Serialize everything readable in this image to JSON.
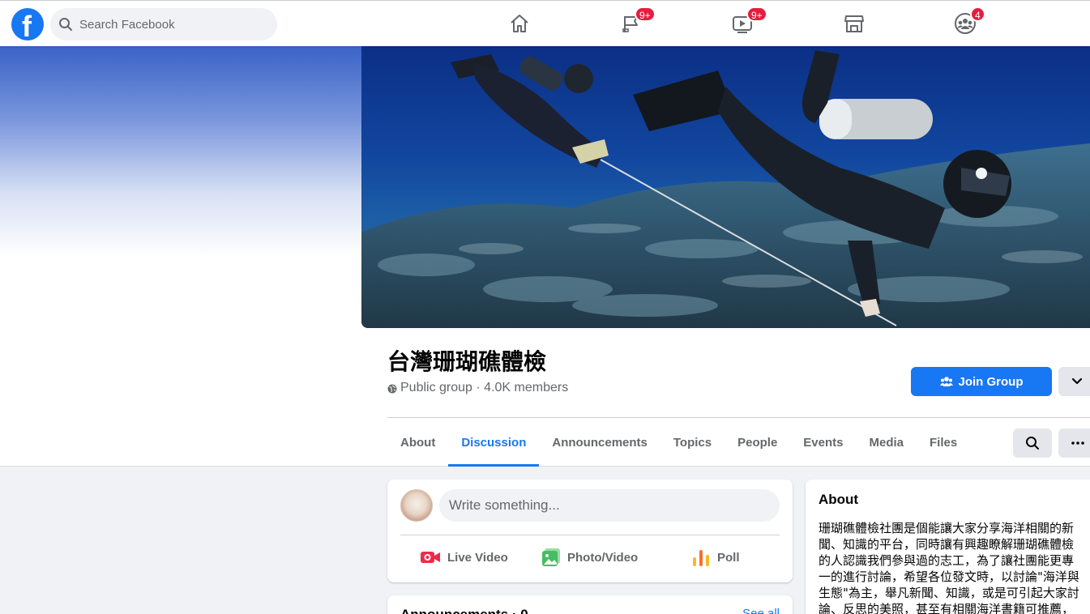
{
  "topbar": {
    "logo_letter": "f",
    "search_placeholder": "Search Facebook",
    "nav": [
      {
        "name": "home",
        "badge": ""
      },
      {
        "name": "pages",
        "badge": "9+"
      },
      {
        "name": "watch",
        "badge": "9+"
      },
      {
        "name": "marketplace",
        "badge": ""
      },
      {
        "name": "groups",
        "badge": "4"
      }
    ]
  },
  "group": {
    "name": "台灣珊瑚礁體檢",
    "meta": "Public group · 4.0K members",
    "join_label": "Join Group"
  },
  "tabs": [
    "About",
    "Discussion",
    "Announcements",
    "Topics",
    "People",
    "Events",
    "Media",
    "Files"
  ],
  "active_tab": "Discussion",
  "composer": {
    "placeholder": "Write something...",
    "actions": [
      "Live Video",
      "Photo/Video",
      "Poll"
    ]
  },
  "announcements": {
    "title": "Announcements · 0",
    "link": "See all"
  },
  "about": {
    "title": "About",
    "text": "珊瑚礁體檢社團是個能讓大家分享海洋相關的新聞、知識的平台，同時讓有興趣瞭解珊瑚礁體檢的人認識我們參與過的志工，為了讓社團能更專一的進行討論，希望各位發文時，以討論\"海洋與生態\"為主，舉凡新聞、知識，或是可引起大家討論、反思的美照，甚至有相關海洋書籍可推薦，"
  },
  "colors": {
    "brand": "#1877f2",
    "badge": "#e41e3f",
    "live": "#f02849",
    "photo": "#45bd62",
    "poll": "#f7b928"
  }
}
